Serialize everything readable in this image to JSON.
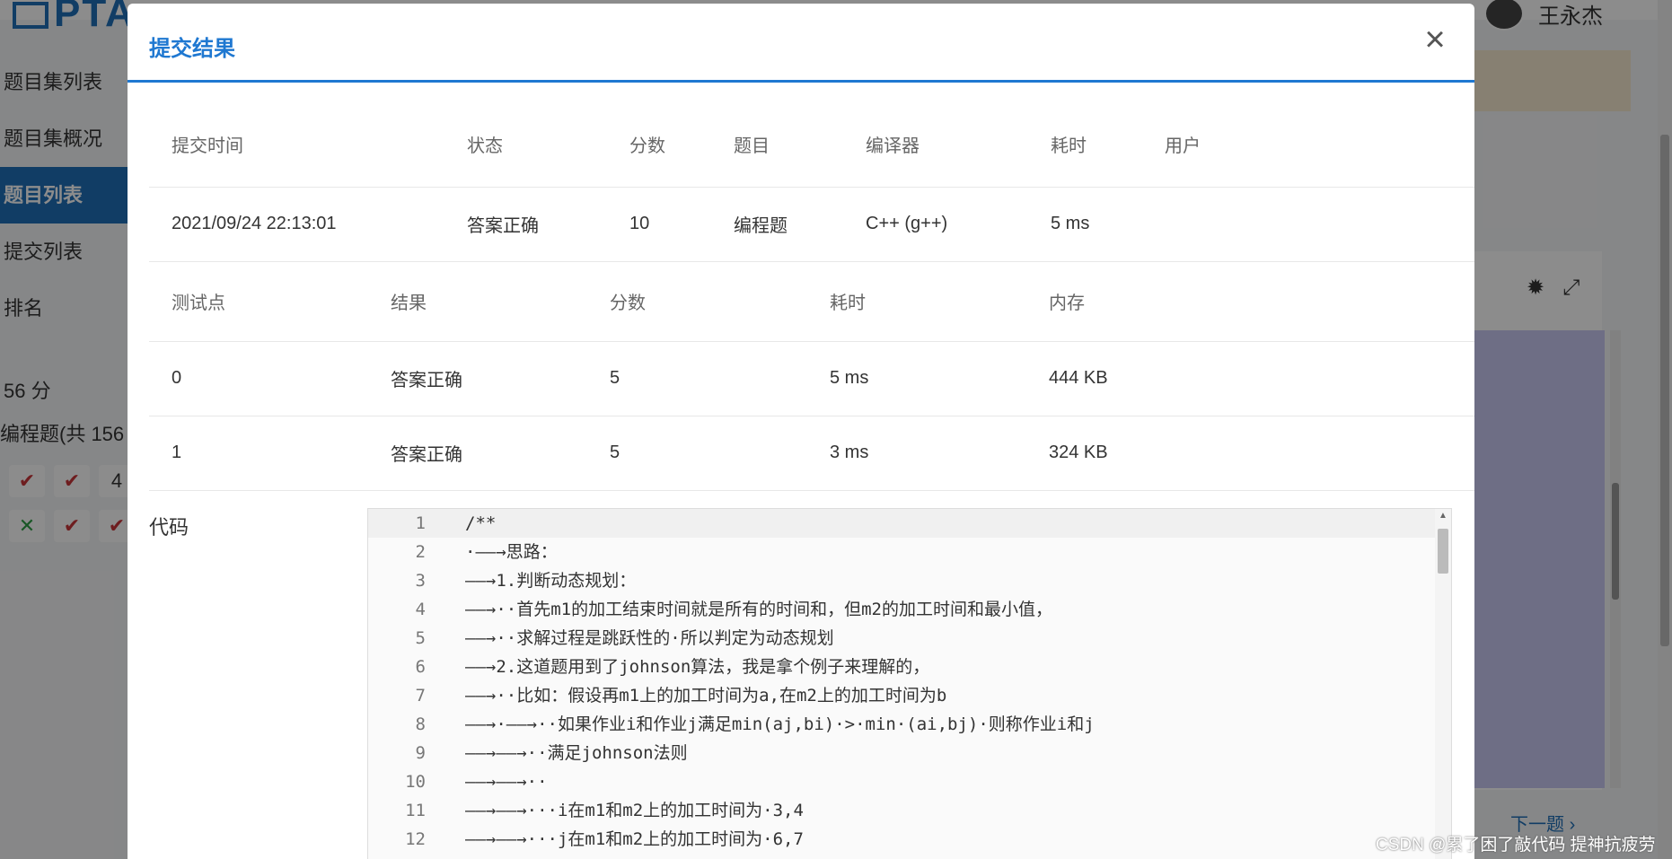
{
  "background": {
    "logo_text": "PTA",
    "user_name": "王永杰",
    "sidebar": [
      {
        "label": "题目集列表"
      },
      {
        "label": "题目集概况"
      },
      {
        "label": "题目列表"
      },
      {
        "label": "提交列表"
      },
      {
        "label": "排名"
      }
    ],
    "score_text": "56 分",
    "section_label": "编程题(共 156",
    "marks": [
      {
        "symbol": "✔",
        "kind": "ok"
      },
      {
        "symbol": "✔",
        "kind": "ok"
      },
      {
        "symbol": "4",
        "kind": "num"
      },
      {
        "symbol": "✕",
        "kind": "bad"
      },
      {
        "symbol": "✔",
        "kind": "ok"
      },
      {
        "symbol": "✔",
        "kind": "ok"
      }
    ],
    "next_label": "下一题"
  },
  "modal": {
    "title": "提交结果",
    "close_symbol": "×",
    "summary": {
      "headers": [
        "提交时间",
        "状态",
        "分数",
        "题目",
        "编译器",
        "耗时",
        "用户"
      ],
      "row": [
        "2021/09/24 22:13:01",
        "答案正确",
        "10",
        "编程题",
        "C++ (g++)",
        "5 ms",
        ""
      ]
    },
    "tests": {
      "headers": [
        "测试点",
        "结果",
        "分数",
        "耗时",
        "内存"
      ],
      "rows": [
        [
          "0",
          "答案正确",
          "5",
          "5 ms",
          "444 KB"
        ],
        [
          "1",
          "答案正确",
          "5",
          "3 ms",
          "324 KB"
        ]
      ]
    },
    "code_label": "代码",
    "code_lines": [
      "/**",
      "·——→思路：",
      "——→1.判断动态规划：",
      "——→··首先m1的加工结束时间就是所有的时间和，但m2的加工时间和最小值，",
      "——→··求解过程是跳跃性的·所以判定为动态规划",
      "——→2.这道题用到了johnson算法，我是拿个例子来理解的，",
      "——→··比如：假设再m1上的加工时间为a,在m2上的加工时间为b",
      "——→·——→··如果作业i和作业j满足min(aj,bi)·>·min·(ai,bj)·则称作业i和j",
      "——→——→··满足johnson法则",
      "——→——→··",
      "——→——→···i在m1和m2上的加工时间为·3,4",
      "——→——→···j在m1和m2上的加工时间为·6,7"
    ]
  },
  "watermark": "CSDN @累了困了敲代码 提神抗疲劳"
}
